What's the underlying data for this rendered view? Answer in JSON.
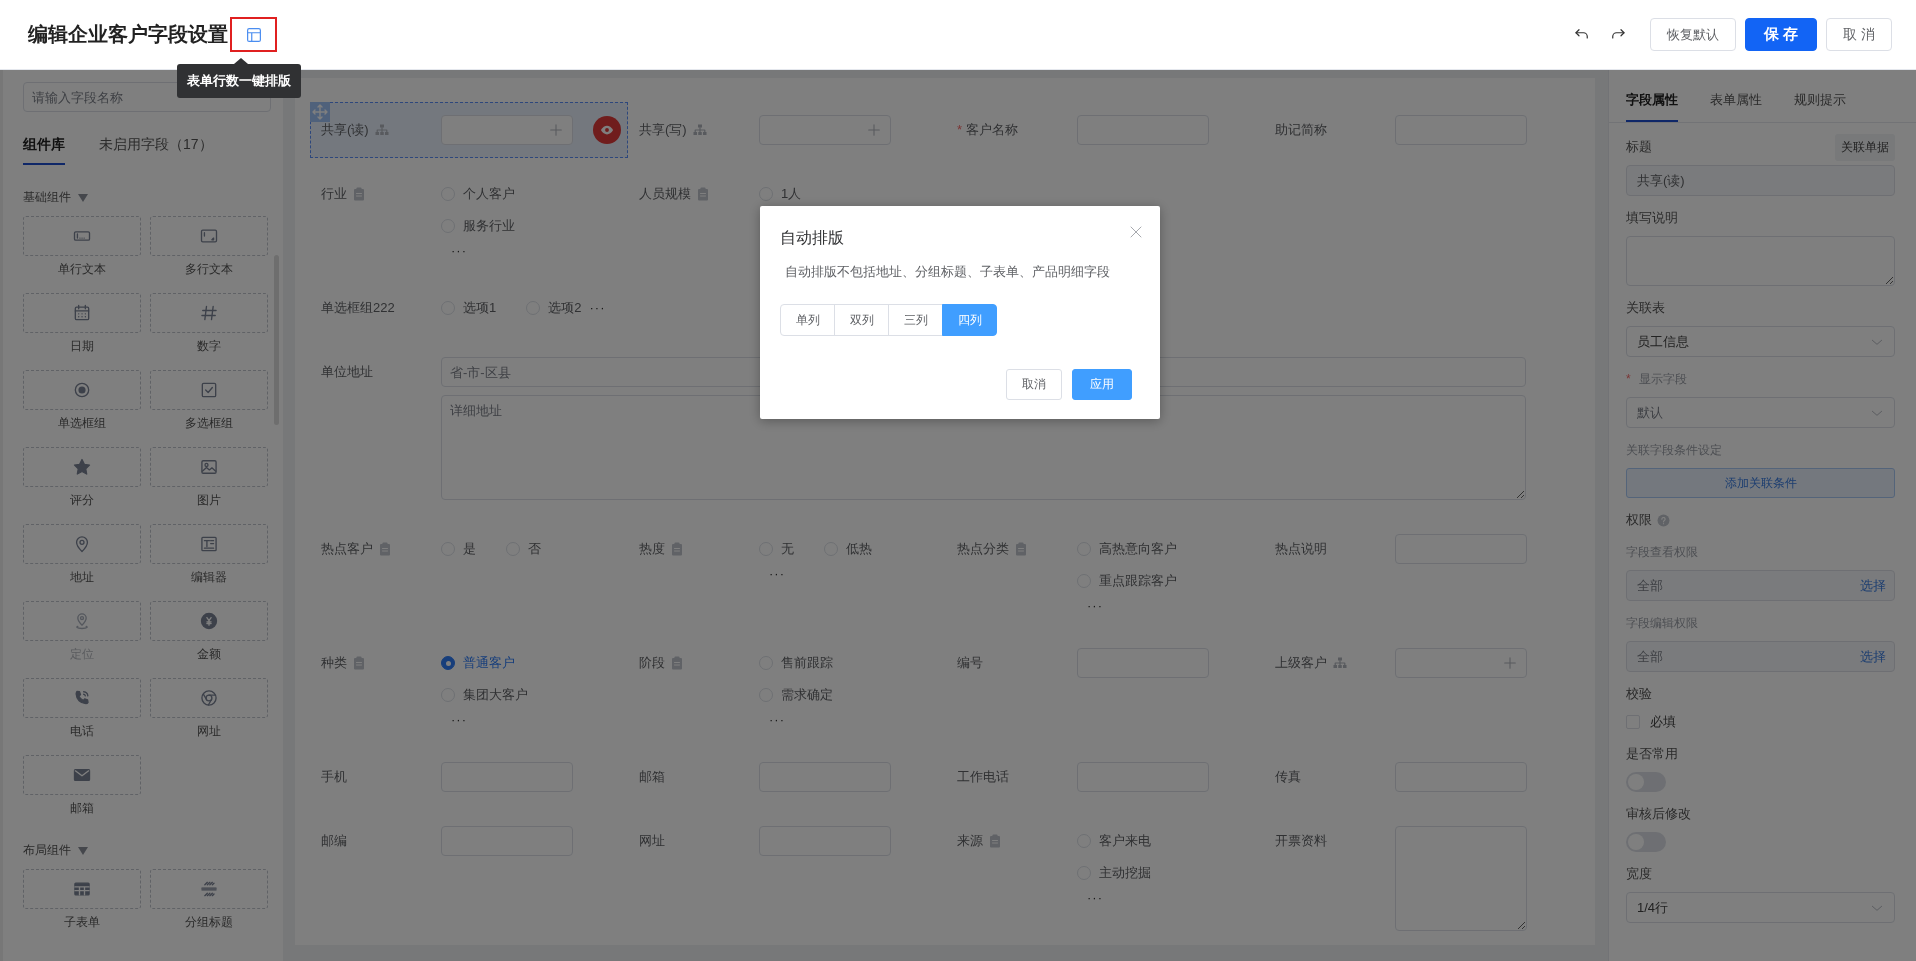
{
  "header": {
    "title": "编辑企业客户字段设置",
    "tooltip": "表单行数一键排版",
    "buttons": [
      {
        "label": "恢复默认",
        "kind": "default"
      },
      {
        "label": "保 存",
        "kind": "primary"
      },
      {
        "label": "取 消",
        "kind": "default"
      }
    ]
  },
  "sidebar": {
    "search_placeholder": "请输入字段名称",
    "tabs": [
      {
        "label": "组件库",
        "selected": true
      },
      {
        "label": "未启用字段（17）",
        "selected": false
      }
    ],
    "groups": [
      {
        "title": "基础组件",
        "expanded": true,
        "items": [
          {
            "label": "单行文本",
            "kind": "text",
            "disabled": false
          },
          {
            "label": "多行文本",
            "kind": "textarea",
            "disabled": false
          },
          {
            "label": "日期",
            "kind": "date",
            "disabled": false
          },
          {
            "label": "数字",
            "kind": "number",
            "disabled": false
          },
          {
            "label": "单选框组",
            "kind": "radio",
            "disabled": false
          },
          {
            "label": "多选框组",
            "kind": "checkbox",
            "disabled": false
          },
          {
            "label": "评分",
            "kind": "rating",
            "disabled": false
          },
          {
            "label": "图片",
            "kind": "image",
            "disabled": false
          },
          {
            "label": "地址",
            "kind": "address",
            "disabled": false
          },
          {
            "label": "编辑器",
            "kind": "editor",
            "disabled": false
          },
          {
            "label": "定位",
            "kind": "location",
            "disabled": true
          },
          {
            "label": "金额",
            "kind": "amount",
            "disabled": false
          },
          {
            "label": "电话",
            "kind": "phone",
            "disabled": false
          },
          {
            "label": "网址",
            "kind": "url",
            "disabled": false
          },
          {
            "label": "邮箱",
            "kind": "email",
            "disabled": false
          }
        ]
      },
      {
        "title": "布局组件",
        "expanded": true,
        "items": [
          {
            "label": "子表单",
            "kind": "subform",
            "disabled": false
          },
          {
            "label": "分组标题",
            "kind": "section",
            "disabled": false
          }
        ]
      }
    ]
  },
  "form": {
    "rows": [
      [
        {
          "label": "共享(读)",
          "kind": "lookup",
          "selected": true
        },
        {
          "label": "共享(写)",
          "kind": "lookup",
          "selected": false
        },
        {
          "label": "客户名称",
          "kind": "input",
          "selected": false,
          "required_mark": "*"
        },
        {
          "label": "助记简称",
          "kind": "input",
          "selected": false
        }
      ],
      [
        {
          "label": "行业",
          "kind": "radio",
          "selected": false,
          "dictionary": true,
          "options": [
            {
              "label": "个人客户",
              "selected": false
            },
            {
              "label": "服务行业",
              "selected": false
            }
          ],
          "more": "···",
          "more_inline": false
        },
        {
          "label": "人员规模",
          "kind": "radio",
          "selected": false,
          "dictionary": true,
          "options": [
            {
              "label": "1人",
              "selected": false
            }
          ]
        }
      ],
      [
        {
          "label": "单选框组222",
          "kind": "radio",
          "selected": false,
          "dictionary": false,
          "options": [
            {
              "label": "选项1",
              "selected": false
            },
            {
              "label": "选项2",
              "selected": false
            }
          ],
          "more": "···",
          "more_inline": true
        }
      ],
      [
        {
          "label": "单位地址",
          "kind": "address",
          "selected": false,
          "placeholder": "省-市-区县",
          "detail_placeholder": "详细地址"
        }
      ],
      [
        {
          "label": "热点客户",
          "kind": "radio",
          "selected": false,
          "dictionary": true,
          "options": [
            {
              "label": "是",
              "selected": false
            },
            {
              "label": "否",
              "selected": false
            }
          ]
        },
        {
          "label": "热度",
          "kind": "radio",
          "selected": false,
          "dictionary": true,
          "options": [
            {
              "label": "无",
              "selected": false
            },
            {
              "label": "低热",
              "selected": false
            }
          ],
          "more": "···",
          "more_inline": false
        },
        {
          "label": "热点分类",
          "kind": "radio",
          "selected": false,
          "dictionary": true,
          "options": [
            {
              "label": "高热意向客户",
              "selected": false
            },
            {
              "label": "重点跟踪客户",
              "selected": false
            }
          ],
          "more": "···",
          "more_inline": false
        },
        {
          "label": "热点说明",
          "kind": "input",
          "selected": false
        }
      ],
      [
        {
          "label": "种类",
          "kind": "radio",
          "selected": false,
          "dictionary": true,
          "options": [
            {
              "label": "普通客户",
              "selected": true
            },
            {
              "label": "集团大客户",
              "selected": false
            }
          ],
          "more": "···",
          "more_inline": false
        },
        {
          "label": "阶段",
          "kind": "radio",
          "selected": false,
          "dictionary": true,
          "options": [
            {
              "label": "售前跟踪",
              "selected": false
            },
            {
              "label": "需求确定",
              "selected": false
            }
          ],
          "more": "···",
          "more_inline": false
        },
        {
          "label": "编号",
          "kind": "input",
          "selected": false
        },
        {
          "label": "上级客户",
          "kind": "lookup",
          "selected": false
        }
      ],
      [
        {
          "label": "手机",
          "kind": "input",
          "selected": false
        },
        {
          "label": "邮箱",
          "kind": "input",
          "selected": false
        },
        {
          "label": "工作电话",
          "kind": "input",
          "selected": false
        },
        {
          "label": "传真",
          "kind": "input",
          "selected": false
        }
      ],
      [
        {
          "label": "邮编",
          "kind": "input",
          "selected": false
        },
        {
          "label": "网址",
          "kind": "input",
          "selected": false
        },
        {
          "label": "来源",
          "kind": "radio",
          "selected": false,
          "dictionary": true,
          "options": [
            {
              "label": "客户来电",
              "selected": false
            },
            {
              "label": "主动挖掘",
              "selected": false
            }
          ],
          "more": "···",
          "more_inline": false
        },
        {
          "label": "开票资料",
          "kind": "textarea",
          "selected": false
        }
      ]
    ]
  },
  "properties": {
    "tabs": [
      {
        "label": "字段属性",
        "selected": true
      },
      {
        "label": "表单属性",
        "selected": false
      },
      {
        "label": "规则提示",
        "selected": false
      }
    ],
    "items": [
      {
        "kind": "label",
        "text": "标题",
        "muted": false,
        "help": false,
        "button": "关联单据"
      },
      {
        "kind": "input",
        "value": "共享(读)"
      },
      {
        "kind": "label",
        "text": "填写说明",
        "muted": false,
        "help": false
      },
      {
        "kind": "textarea"
      },
      {
        "kind": "label",
        "text": "关联表",
        "muted": false,
        "help": false
      },
      {
        "kind": "select",
        "value": "员工信息"
      },
      {
        "kind": "label",
        "text": "显示字段",
        "required_mark": "*",
        "muted": true,
        "help": false
      },
      {
        "kind": "select",
        "placeholder": "默认"
      },
      {
        "kind": "label",
        "text": "关联字段条件设定",
        "muted": true,
        "help": false
      },
      {
        "kind": "button",
        "text": "添加关联条件"
      },
      {
        "kind": "label",
        "text": "权限",
        "muted": false,
        "help": true
      },
      {
        "kind": "label",
        "text": "字段查看权限",
        "muted": true,
        "help": false
      },
      {
        "kind": "picker",
        "placeholder": "全部",
        "link": "选择"
      },
      {
        "kind": "label",
        "text": "字段编辑权限",
        "muted": true,
        "help": false
      },
      {
        "kind": "picker",
        "placeholder": "全部",
        "link": "选择"
      },
      {
        "kind": "label",
        "text": "校验",
        "muted": false,
        "help": false
      },
      {
        "kind": "checkbox",
        "text": "必填",
        "checked": false
      },
      {
        "kind": "label",
        "text": "是否常用",
        "muted": false,
        "help": false
      },
      {
        "kind": "switch",
        "on": false
      },
      {
        "kind": "label",
        "text": "审核后修改",
        "muted": false,
        "help": false
      },
      {
        "kind": "switch",
        "on": false
      },
      {
        "kind": "label",
        "text": "宽度",
        "muted": false,
        "help": false
      },
      {
        "kind": "select",
        "value": "1/4行"
      }
    ]
  },
  "dialog": {
    "title": "自动排版",
    "message": "自动排版不包括地址、分组标题、子表单、产品明细字段",
    "options": [
      {
        "label": "单列",
        "selected": false
      },
      {
        "label": "双列",
        "selected": false
      },
      {
        "label": "三列",
        "selected": false
      },
      {
        "label": "四列",
        "selected": true
      }
    ],
    "buttons": [
      {
        "label": "取消",
        "kind": "default"
      },
      {
        "label": "应用",
        "kind": "primary"
      }
    ]
  }
}
